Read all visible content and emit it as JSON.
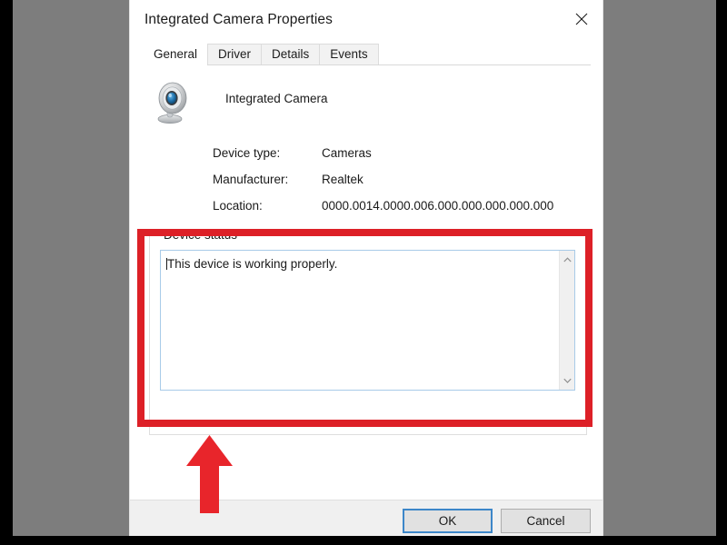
{
  "window": {
    "title": "Integrated Camera Properties",
    "close_icon": "close-x-icon"
  },
  "tabs": [
    {
      "label": "General",
      "active": true
    },
    {
      "label": "Driver",
      "active": false
    },
    {
      "label": "Details",
      "active": false
    },
    {
      "label": "Events",
      "active": false
    }
  ],
  "general": {
    "device_icon": "webcam-icon",
    "device_name": "Integrated Camera",
    "properties": [
      {
        "label": "Device type:",
        "value": "Cameras"
      },
      {
        "label": "Manufacturer:",
        "value": "Realtek"
      },
      {
        "label": "Location:",
        "value": "0000.0014.0000.006.000.000.000.000.000"
      }
    ],
    "device_status": {
      "group_label": "Device status",
      "text": "This device is working properly.",
      "scroll_up_icon": "chevron-up-icon",
      "scroll_down_icon": "chevron-down-icon"
    }
  },
  "footer": {
    "ok_label": "OK",
    "cancel_label": "Cancel"
  },
  "annotations": {
    "highlight_color": "#dd2027",
    "arrow_icon": "arrow-up-icon",
    "rect_target": "device-status-group"
  },
  "colors": {
    "background": "#7d7d7d",
    "dialog": "#ffffff",
    "footer": "#f0f0f0",
    "accent_blue": "#3d87c9",
    "textbox_border": "#a8cbe8"
  }
}
